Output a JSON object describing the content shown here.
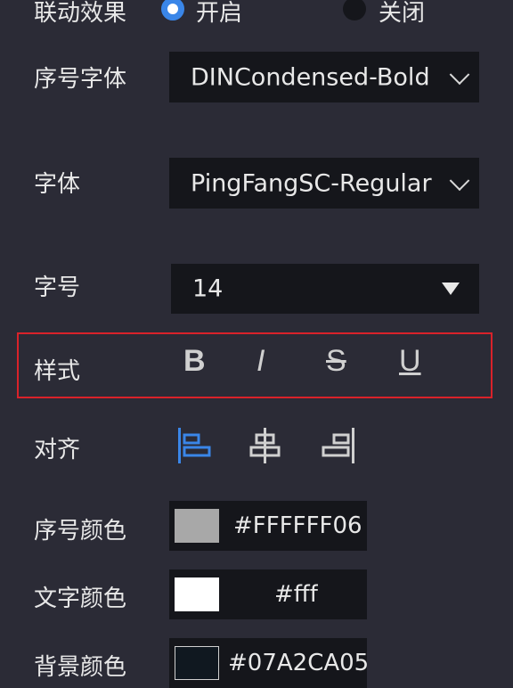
{
  "linkage": {
    "label": "联动效果",
    "options": [
      {
        "label": "开启",
        "selected": true
      },
      {
        "label": "关闭",
        "selected": false
      }
    ]
  },
  "index_font": {
    "label": "序号字体",
    "value": "DINCondensed-Bold"
  },
  "font": {
    "label": "字体",
    "value": "PingFangSC-Regular"
  },
  "font_size": {
    "label": "字号",
    "value": "14"
  },
  "text_style": {
    "label": "样式",
    "buttons": [
      "B",
      "I",
      "S",
      "U"
    ]
  },
  "align": {
    "label": "对齐",
    "options": [
      "align-left-icon",
      "align-center-icon",
      "align-right-icon"
    ],
    "selected": "align-left-icon"
  },
  "index_color": {
    "label": "序号颜色",
    "value": "#FFFFFF06",
    "swatch": "#a8a8a8"
  },
  "text_color": {
    "label": "文字颜色",
    "value": "#fff",
    "swatch": "#ffffff"
  },
  "bg_color": {
    "label": "背景颜色",
    "value": "#07A2CA05",
    "swatch": "#101820"
  },
  "colors": {
    "accent": "#3a86e8",
    "highlight": "#d9222a",
    "panel": "#2b2b36",
    "field": "#15161b"
  }
}
